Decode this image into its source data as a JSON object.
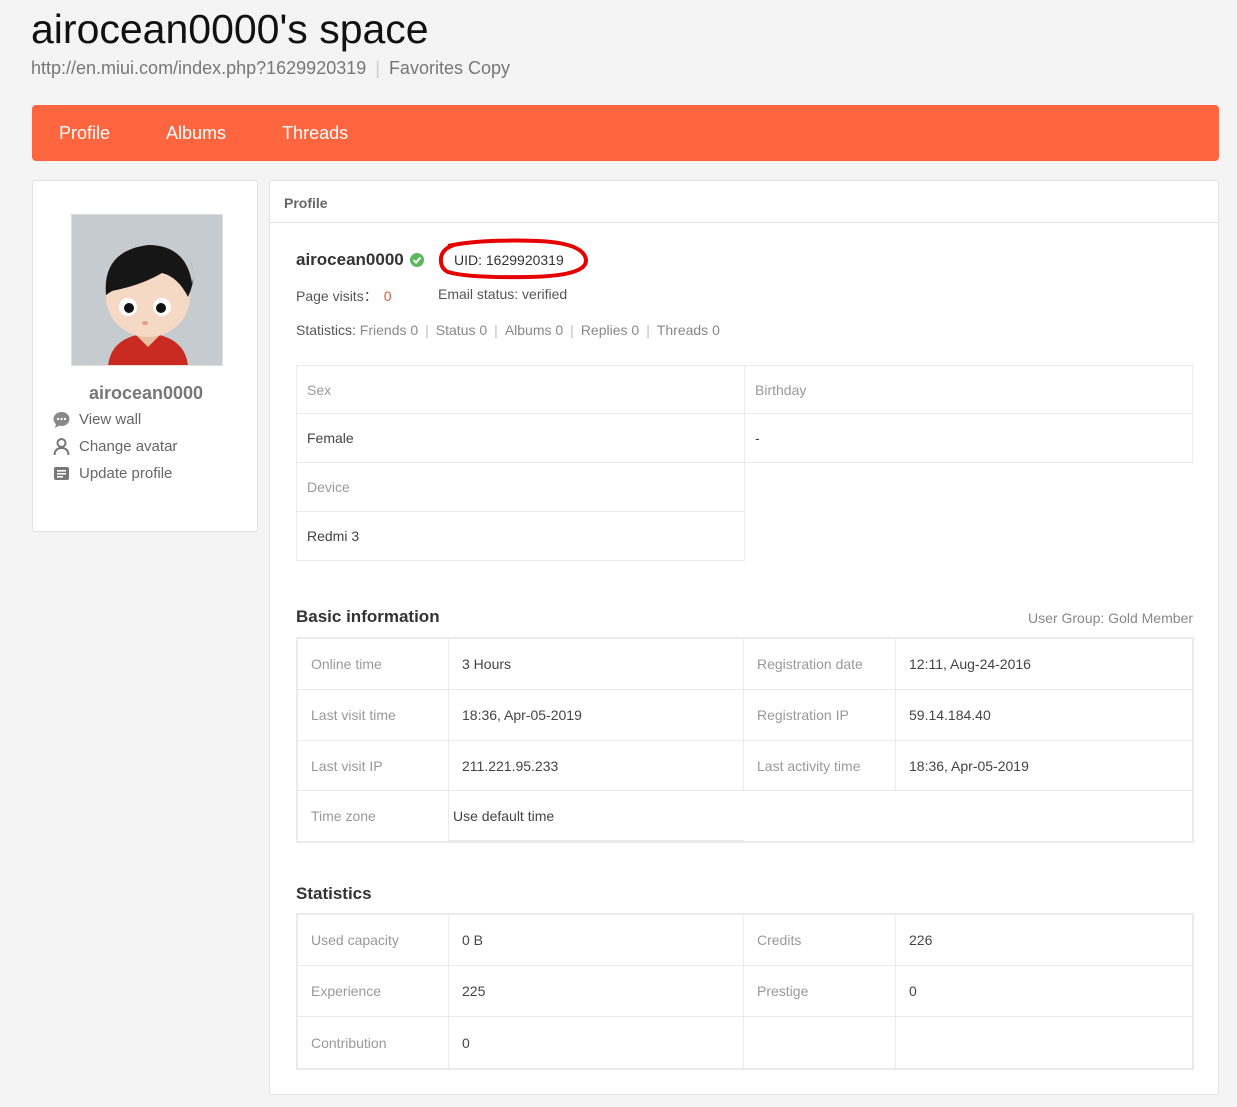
{
  "header": {
    "title": "airocean0000's space",
    "url": "http://en.miui.com/index.php?1629920319",
    "favorites_label": "Favorites",
    "copy_label": "Copy"
  },
  "nav": {
    "items": [
      "Profile",
      "Albums",
      "Threads"
    ]
  },
  "colors": {
    "accent": "#ff6640",
    "verified": "#5cb85c",
    "highlight_circle": "#e60000"
  },
  "sidebar": {
    "username": "airocean0000",
    "links": [
      {
        "label": "View wall",
        "icon": "speech-bubble-icon"
      },
      {
        "label": "Change avatar",
        "icon": "person-icon"
      },
      {
        "label": "Update profile",
        "icon": "document-icon"
      }
    ]
  },
  "profile": {
    "section_label": "Profile",
    "username": "airocean0000",
    "uid": "UID: 1629920319",
    "page_visits_label": "Page visits：",
    "page_visits_value": "0",
    "email_status_label": "Email status:",
    "email_status_value": "verified",
    "statistics_label": "Statistics: ",
    "stat_links": [
      "Friends 0",
      "Status 0",
      "Albums 0",
      "Replies 0",
      "Threads 0"
    ],
    "fields": {
      "sex_label": "Sex",
      "sex_value": "Female",
      "birthday_label": "Birthday",
      "birthday_value": "-",
      "device_label": "Device",
      "device_value": "Redmi 3"
    }
  },
  "basic_info": {
    "title": "Basic information",
    "user_group": "User Group: Gold Member",
    "rows": [
      [
        "Online time",
        "3 Hours",
        "Registration date",
        "12:11, Aug-24-2016"
      ],
      [
        "Last visit time",
        "18:36, Apr-05-2019",
        "Registration IP",
        "59.14.184.40"
      ],
      [
        "Last visit IP",
        "211.221.95.233",
        "Last activity time",
        "18:36, Apr-05-2019"
      ],
      [
        "Time zone",
        "Use default time",
        "",
        ""
      ]
    ]
  },
  "statistics": {
    "title": "Statistics",
    "rows": [
      [
        "Used capacity",
        "0 B",
        "Credits",
        "226"
      ],
      [
        "Experience",
        "225",
        "Prestige",
        "0"
      ],
      [
        "Contribution",
        "0",
        "",
        ""
      ]
    ]
  }
}
